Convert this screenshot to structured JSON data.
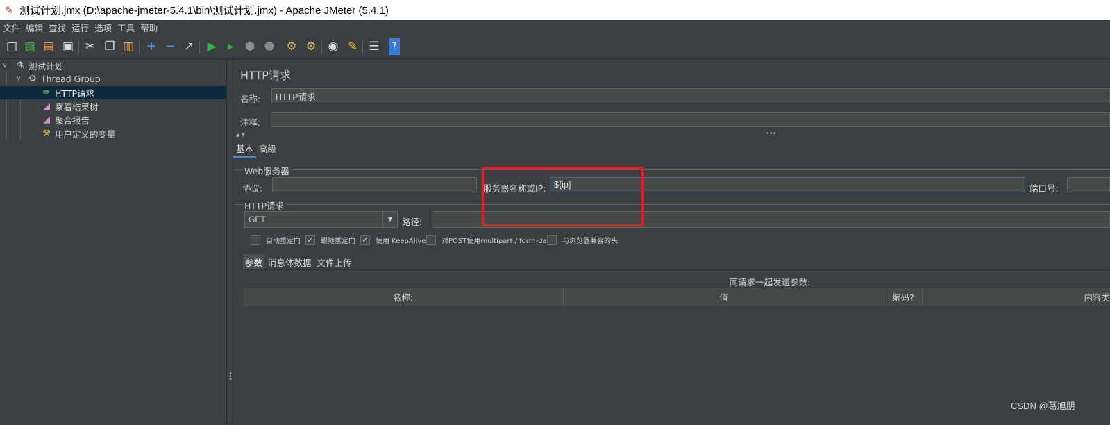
{
  "window": {
    "title": "测试计划.jmx (D:\\apache-jmeter-5.4.1\\bin\\测试计划.jmx) - Apache JMeter (5.4.1)"
  },
  "menu": [
    "文件",
    "编辑",
    "查找",
    "运行",
    "选项",
    "工具",
    "帮助"
  ],
  "toolbar": {
    "icons": [
      "new-icon",
      "templates-icon",
      "open-icon",
      "save-icon",
      "cut-icon",
      "copy-icon",
      "paste-icon",
      "expand-icon",
      "collapse-icon",
      "toggle-icon",
      "start-icon",
      "start-no-pause-icon",
      "stop-icon",
      "shutdown-icon",
      "clear-icon",
      "clear-all-icon",
      "search-icon",
      "reset-search-icon",
      "function-helper-icon",
      "help-icon"
    ]
  },
  "tree": {
    "test_plan": "测试计划",
    "thread_group": "Thread Group",
    "http_request": "HTTP请求",
    "view_results_tree": "察看结果树",
    "aggregate_report": "聚合报告",
    "user_defined_vars": "用户定义的变量"
  },
  "panel": {
    "title": "HTTP请求",
    "name_label": "名称:",
    "name_value": "HTTP请求",
    "comment_label": "注释:",
    "comment_value": "",
    "tabs": [
      "基本",
      "高级"
    ],
    "web_server": {
      "section_title": "Web服务器",
      "protocol_label": "协议:",
      "protocol_value": "",
      "server_label": "服务器名称或IP:",
      "server_value": "${ip}",
      "port_label": "端口号:",
      "port_value": ""
    },
    "http_request": {
      "section_title": "HTTP请求",
      "method": "GET",
      "path_label": "路径:",
      "path_value": ""
    },
    "checkboxes": [
      {
        "label": "自动重定向",
        "checked": false
      },
      {
        "label": "跟随重定向",
        "checked": true
      },
      {
        "label": "使用 KeepAlive",
        "checked": true
      },
      {
        "label": "对POST使用multipart / form-data",
        "checked": false
      },
      {
        "label": "与浏览器兼容的头",
        "checked": false
      }
    ],
    "subtabs": [
      "参数",
      "消息体数据",
      "文件上传"
    ],
    "params": {
      "caption": "同请求一起发送参数:",
      "columns": [
        "名称:",
        "值",
        "编码?",
        "内容类"
      ]
    }
  },
  "watermark": "CSDN @葛旭朋"
}
